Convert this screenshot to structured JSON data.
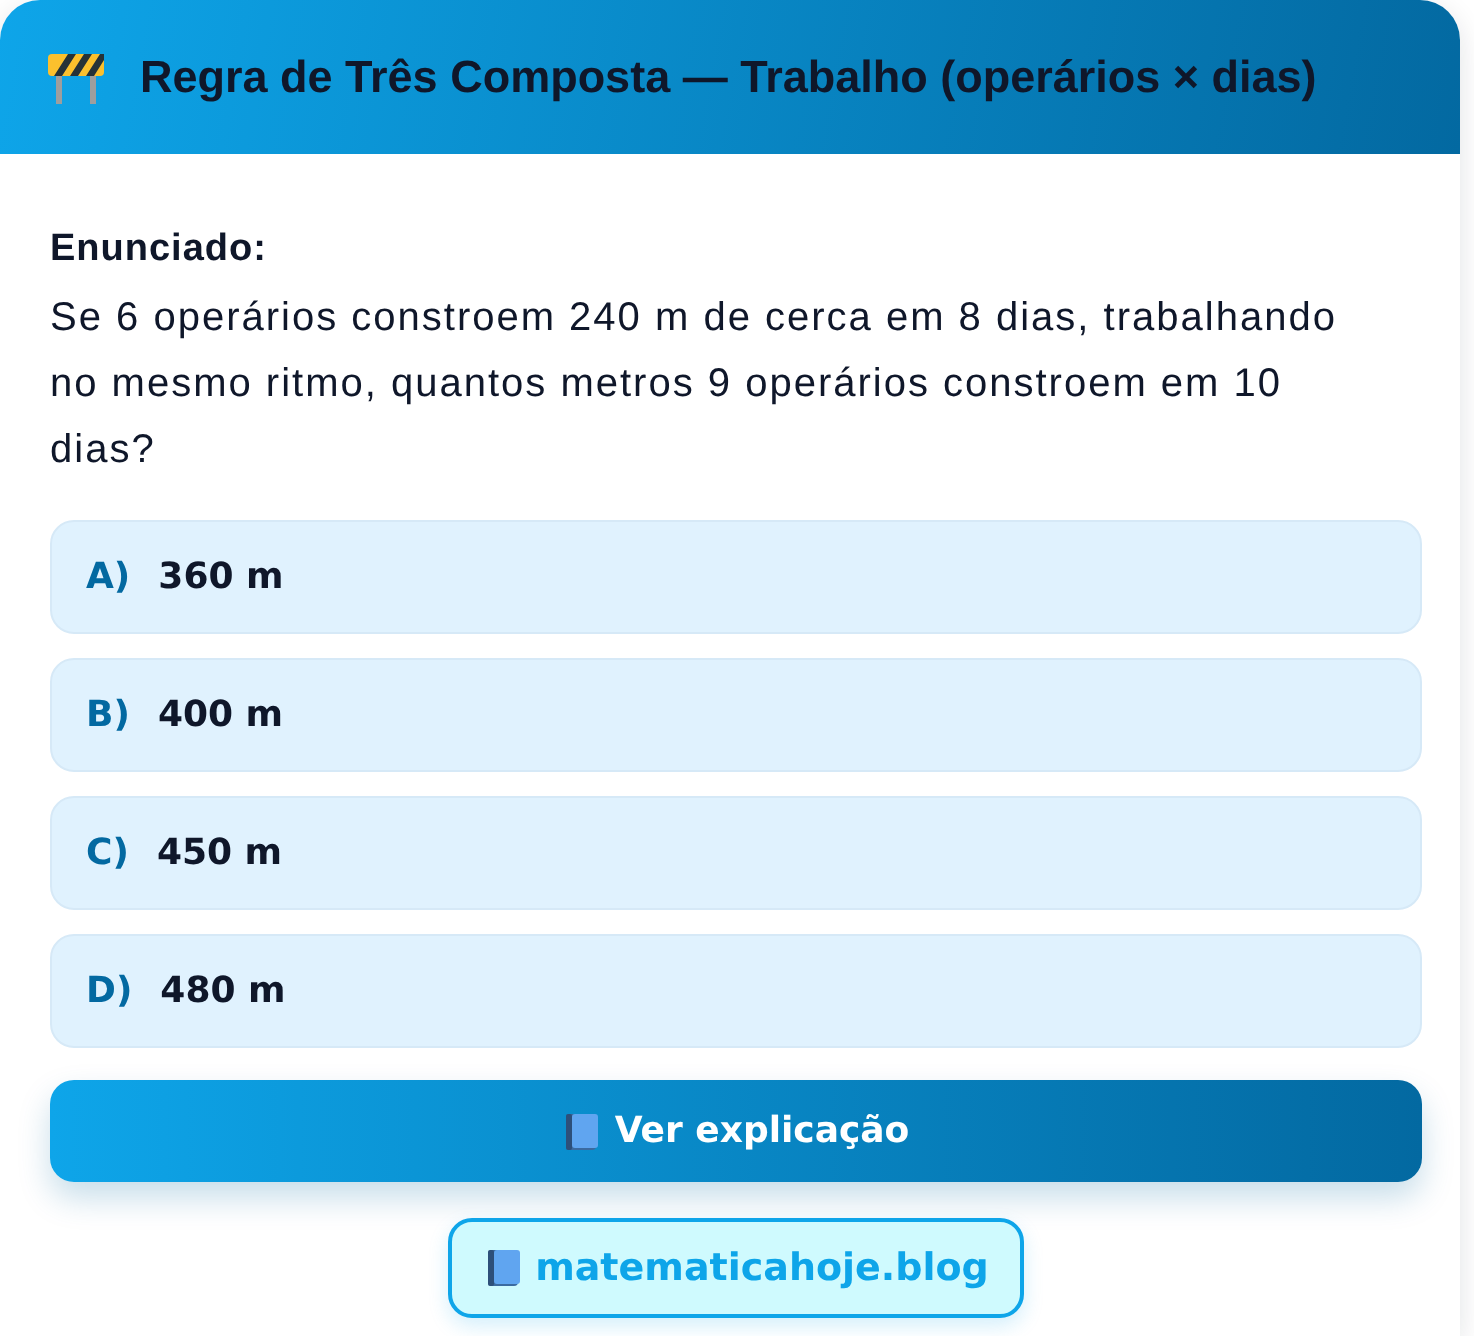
{
  "header": {
    "title": "Regra de Três Composta — Trabalho (operários × dias)"
  },
  "question": {
    "label": "Enunciado:",
    "text": "Se 6 operários constroem 240 m de cerca em 8 dias, trabalhando no mesmo ritmo, quantos metros 9 operários constroem em 10 dias?"
  },
  "options": [
    {
      "letter": "A)",
      "value": "360 m"
    },
    {
      "letter": "B)",
      "value": "400 m"
    },
    {
      "letter": "C)",
      "value": "450 m"
    },
    {
      "letter": "D)",
      "value": "480 m"
    }
  ],
  "explain_button": {
    "label": "Ver explicação"
  },
  "site_link": {
    "label": "matematicahoje.blog"
  }
}
